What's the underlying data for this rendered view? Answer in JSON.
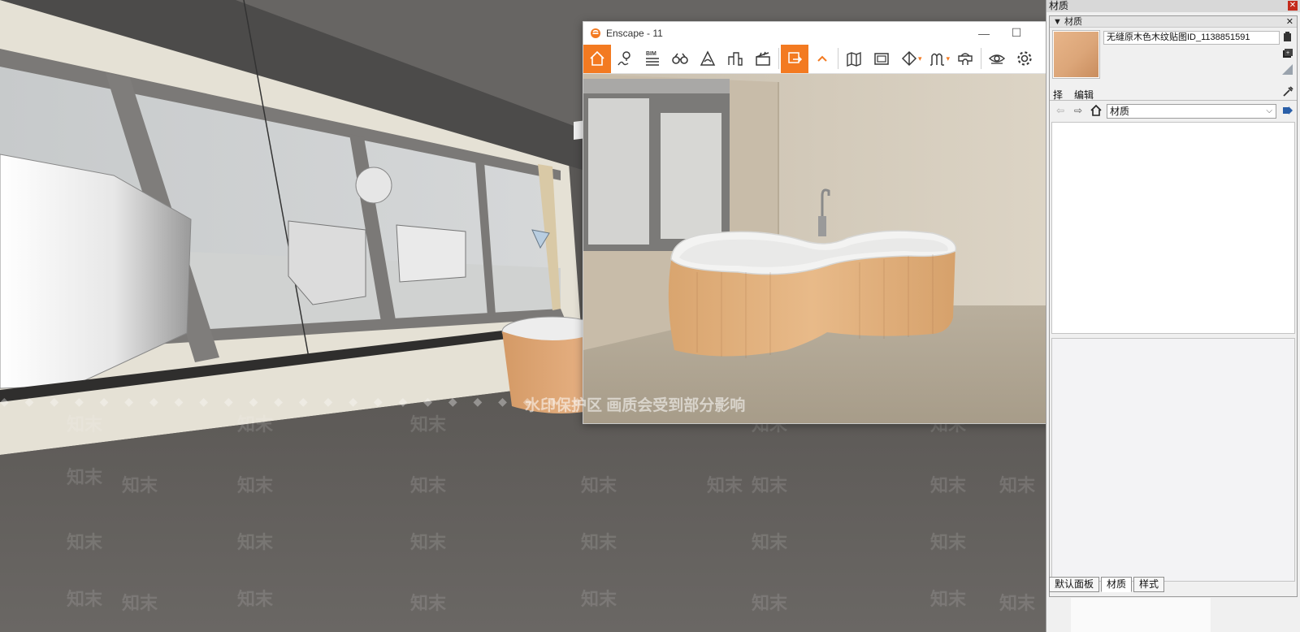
{
  "watermark": {
    "text": "知末",
    "notice": "水印保护区 画质会受到部分影响",
    "band": "◆ ◆ ◆ ◆ ◆ ◆ ◆ ◆ ◆ ◆ ◆ ◆ ◆ ◆ ◆ ◆ ◆ ◆ ◆ ◆ ◆ ◆ ◆ ◆ ◆ ◆ ◆ ◆ ◆ ◆ ◆ ◆ ◆ ◆ ◆ ◆ ◆ ◆ ◆ ◆ ◆ ◆ ◆ ◆ ◆ ◆ ◆ ◆ ◆ ◆"
  },
  "enscape": {
    "title": "Enscape - 11",
    "accent": "#f37a21",
    "controls": {
      "minimize": "—",
      "maximize": "☐",
      "close": "✕"
    },
    "toolbar": {
      "items": [
        {
          "name": "home-icon",
          "active": true
        },
        {
          "name": "locations-icon",
          "active": false
        },
        {
          "name": "bim-icon",
          "label": "BIM",
          "active": false
        },
        {
          "name": "binoculars-icon",
          "active": false
        },
        {
          "name": "atmosphere-icon",
          "active": false
        },
        {
          "name": "buildings-icon",
          "active": false
        },
        {
          "name": "clapperboard-icon",
          "active": false
        },
        {
          "name": "export-icon",
          "active": true
        },
        {
          "name": "collapse-icon",
          "active": false
        },
        {
          "name": "map-icon",
          "active": false
        },
        {
          "name": "gallery-icon",
          "active": false
        },
        {
          "name": "section-icon",
          "active": false
        },
        {
          "name": "assets-icon",
          "active": false
        },
        {
          "name": "vr-headset-icon",
          "active": false
        },
        {
          "name": "eye-icon",
          "active": false
        },
        {
          "name": "settings-icon",
          "active": false
        }
      ]
    }
  },
  "tray": {
    "title": "材质",
    "close": "✕",
    "materials_header": "材质",
    "materials_header_arrow": "▼",
    "material_name": "无缝原木色木纹贴图ID_1138851591",
    "tabs": {
      "select": "择",
      "edit": "编辑"
    },
    "library": "材质",
    "bottom_tabs": [
      "默认面板",
      "材质",
      "样式"
    ]
  }
}
